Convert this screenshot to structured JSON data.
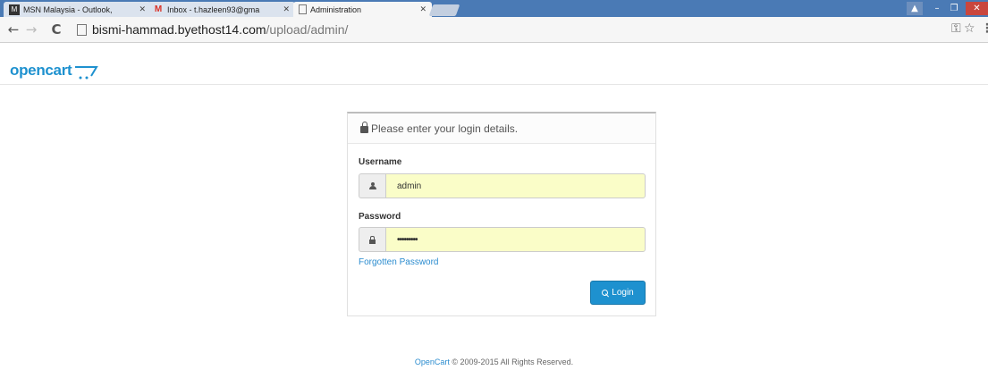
{
  "browser": {
    "tabs": [
      {
        "title": "MSN Malaysia - Outlook, ",
        "icon": "msn-icon"
      },
      {
        "title": "Inbox - t.hazleen93@gma",
        "icon": "gmail-icon"
      },
      {
        "title": "Administration",
        "icon": "page-icon"
      }
    ],
    "url_host": "bismi-hammad.byethost14.com",
    "url_path": "/upload/admin/"
  },
  "brand": {
    "logo_text": "opencart",
    "accent": "#1e91cf"
  },
  "login": {
    "heading": "Please enter your login details.",
    "username_label": "Username",
    "username_value": "admin",
    "password_label": "Password",
    "password_value": "•••••••••",
    "forgot_link": "Forgotten Password",
    "submit_label": "Login"
  },
  "footer": {
    "link_text": "OpenCart",
    "rest": " © 2009-2015 All Rights Reserved."
  }
}
